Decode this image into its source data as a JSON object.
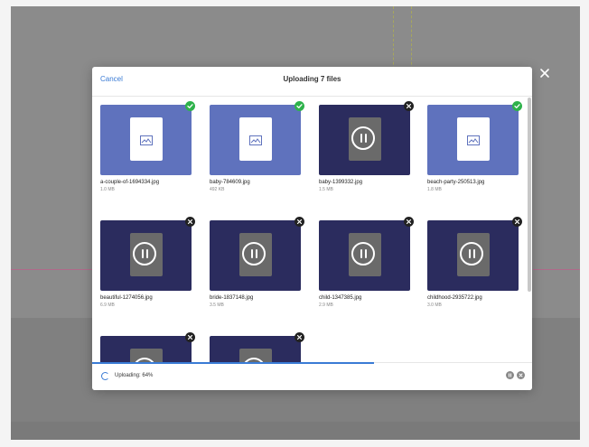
{
  "dialog": {
    "cancel_label": "Cancel",
    "title": "Uploading 7 files"
  },
  "files": [
    {
      "name": "a-couple-of-1694334.jpg",
      "size": "1.0 MB",
      "state": "complete"
    },
    {
      "name": "baby-784609.jpg",
      "size": "492 KB",
      "state": "complete"
    },
    {
      "name": "baby-1399332.jpg",
      "size": "1.5 MB",
      "state": "paused"
    },
    {
      "name": "beach-party-250513.jpg",
      "size": "1.8 MB",
      "state": "complete"
    },
    {
      "name": "beautiful-1274056.jpg",
      "size": "6.9 MB",
      "state": "paused"
    },
    {
      "name": "bride-1837148.jpg",
      "size": "3.5 MB",
      "state": "paused"
    },
    {
      "name": "child-1347385.jpg",
      "size": "2.9 MB",
      "state": "paused"
    },
    {
      "name": "childhood-2935722.jpg",
      "size": "3.0 MB",
      "state": "paused"
    },
    {
      "name": "",
      "size": "",
      "state": "paused"
    },
    {
      "name": "",
      "size": "",
      "state": "paused"
    }
  ],
  "status": {
    "text": "Uploading: 64%",
    "progress": 0.64
  },
  "colors": {
    "accent": "#3a7bd5",
    "complete_thumb": "#5f72bd",
    "paused_thumb": "#2b2c5e",
    "success": "#2eb24b"
  },
  "icons": {
    "close": "close-icon",
    "complete_badge": "check-icon",
    "remove_badge": "remove-icon",
    "image": "image-icon",
    "pause": "pause-icon",
    "spinner": "spinner-icon",
    "pause_all": "pause-all-icon",
    "cancel_all": "cancel-all-icon"
  }
}
